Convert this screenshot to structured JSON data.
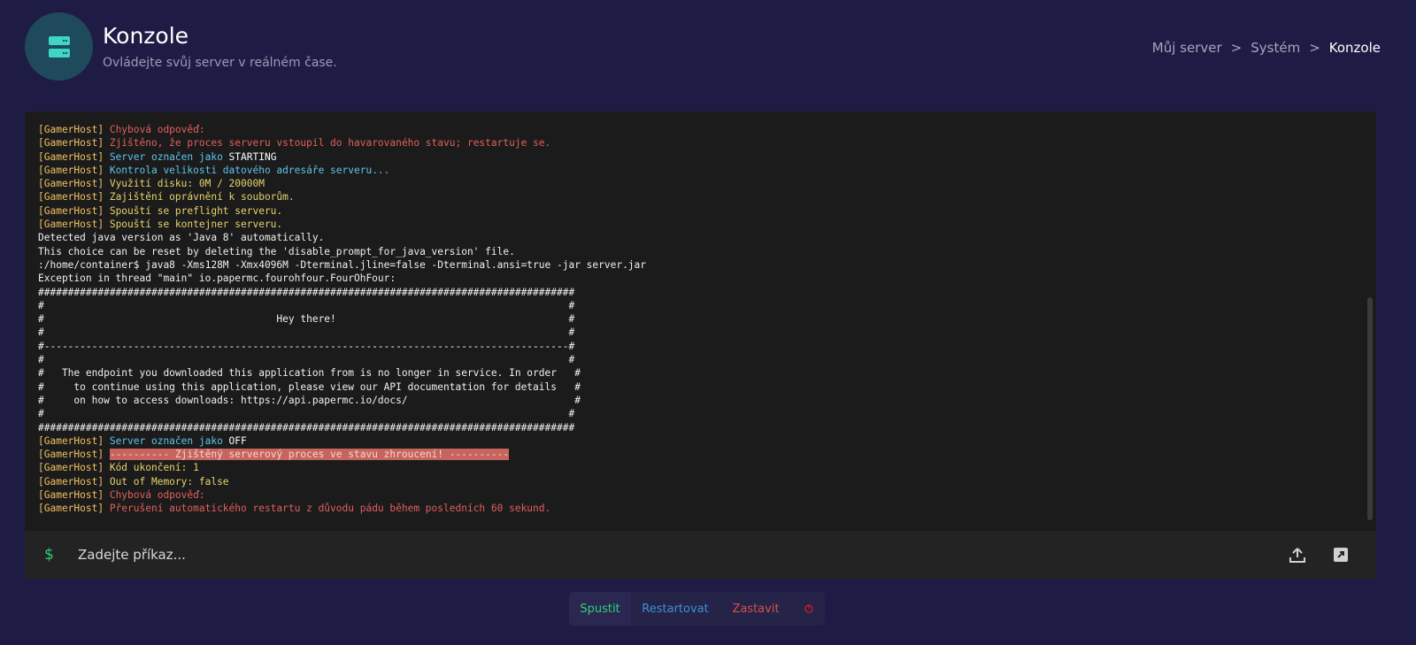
{
  "header": {
    "title": "Konzole",
    "subtitle": "Ovládejte svůj server v reálném čase.",
    "icon": "server-icon",
    "breadcrumb": [
      "Můj server",
      "Systém",
      "Konzole"
    ]
  },
  "console": {
    "lines": [
      {
        "tag": "[GamerHost]",
        "text": " Chybová odpověď:",
        "color": "red"
      },
      {
        "tag": "[GamerHost]",
        "text": " Zjištěno, že proces serveru vstoupil do havarovaného stavu; restartuje se.",
        "color": "red"
      },
      {
        "tag": "[GamerHost]",
        "text": " Server označen jako ",
        "color": "cyan",
        "highlight": "STARTING"
      },
      {
        "tag": "[GamerHost]",
        "text": " Kontrola velikosti datového adresáře serveru...",
        "color": "cyan"
      },
      {
        "tag": "[GamerHost]",
        "text": " Využití disku: 0M / 20000M",
        "color": "yellow"
      },
      {
        "tag": "[GamerHost]",
        "text": " Zajištění oprávnění k souborům.",
        "color": "yellow"
      },
      {
        "tag": "[GamerHost]",
        "text": " Spouští se preflight serveru.",
        "color": "yellow"
      },
      {
        "tag": "[GamerHost]",
        "text": " Spouští se kontejner serveru.",
        "color": "yellow"
      },
      {
        "tag": "",
        "text": "Detected java version as 'Java 8' automatically.",
        "color": "white"
      },
      {
        "tag": "",
        "text": "This choice can be reset by deleting the 'disable_prompt_for_java_version' file.",
        "color": "white"
      },
      {
        "tag": "",
        "text": ":/home/container$ java8 -Xms128M -Xmx4096M -Dterminal.jline=false -Dterminal.ansi=true -jar server.jar",
        "color": "white"
      },
      {
        "tag": "",
        "text": "Exception in thread \"main\" io.papermc.fourohfour.FourOhFour:",
        "color": "white"
      },
      {
        "tag": "",
        "text": "##########################################################################################",
        "color": "white"
      },
      {
        "tag": "",
        "text": "#                                                                                        #",
        "color": "white"
      },
      {
        "tag": "",
        "text": "#                                       Hey there!                                       #",
        "color": "white"
      },
      {
        "tag": "",
        "text": "#                                                                                        #",
        "color": "white"
      },
      {
        "tag": "",
        "text": "#----------------------------------------------------------------------------------------#",
        "color": "white"
      },
      {
        "tag": "",
        "text": "#                                                                                        #",
        "color": "white"
      },
      {
        "tag": "",
        "text": "#   The endpoint you downloaded this application from is no longer in service. In order   #",
        "color": "white"
      },
      {
        "tag": "",
        "text": "#     to continue using this application, please view our API documentation for details   #",
        "color": "white"
      },
      {
        "tag": "",
        "text": "#     on how to access downloads: https://api.papermc.io/docs/                            #",
        "color": "white"
      },
      {
        "tag": "",
        "text": "#                                                                                        #",
        "color": "white"
      },
      {
        "tag": "",
        "text": "##########################################################################################",
        "color": "white"
      },
      {
        "tag": "[GamerHost]",
        "text": " Server označen jako ",
        "color": "cyan",
        "highlight": "OFF"
      },
      {
        "tag": "[GamerHost]",
        "text": "---------- Zjištěný serverový proces ve stavu zhroucení! ----------",
        "color": "redbg"
      },
      {
        "tag": "[GamerHost]",
        "text": " Kód ukončení: 1",
        "color": "yellow"
      },
      {
        "tag": "[GamerHost]",
        "text": " Out of Memory: false",
        "color": "yellow"
      },
      {
        "tag": "[GamerHost]",
        "text": " Chybová odpověď:",
        "color": "red"
      },
      {
        "tag": "[GamerHost]",
        "text": " Přerušení automatického restartu z důvodu pádu během posledních 60 sekund.",
        "color": "red"
      }
    ]
  },
  "command": {
    "prompt": "$",
    "placeholder": "Zadejte příkaz...",
    "upload_icon": "upload-icon",
    "expand_icon": "expand-icon"
  },
  "power": {
    "start_label": "Spustit",
    "restart_label": "Restartovat",
    "stop_label": "Zastavit",
    "kill_icon": "power-icon"
  },
  "colors": {
    "background": "#1e1c44",
    "console_bg": "#1b1b1c",
    "tag": "#f0c060",
    "red": "#e0605a",
    "cyan": "#5fc4e6",
    "yellow": "#e6d36a",
    "selection": "#26574c",
    "accent_green": "#2ecc71"
  }
}
